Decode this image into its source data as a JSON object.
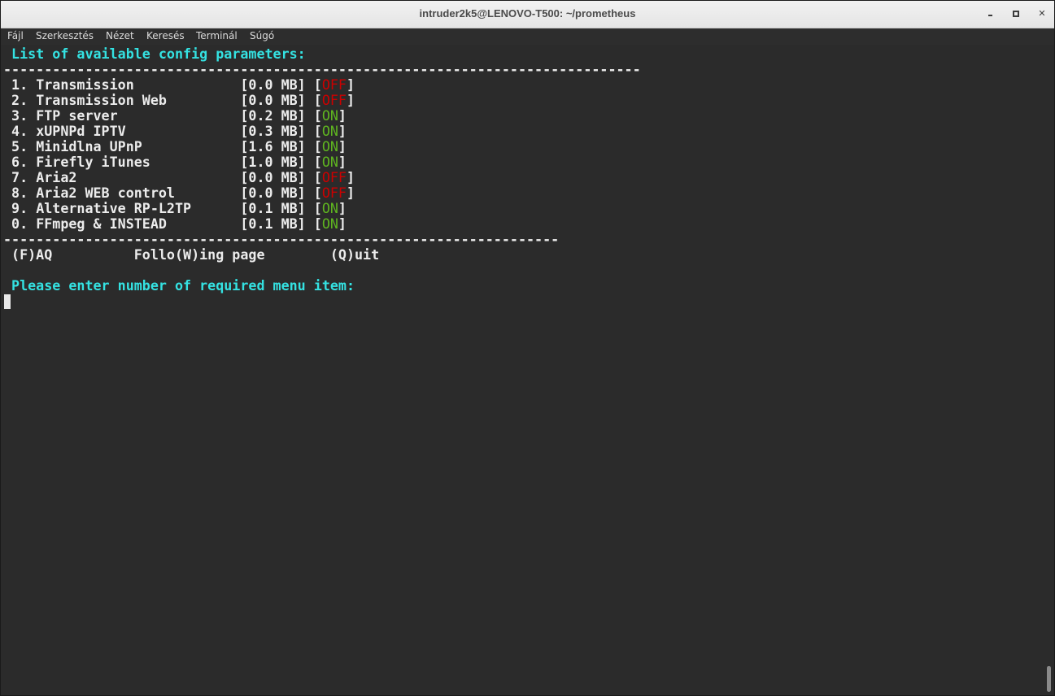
{
  "window": {
    "title": "intruder2k5@LENOVO-T500: ~/prometheus",
    "controls": [
      "minimize-icon",
      "maximize-icon",
      "close-icon"
    ]
  },
  "menubar": {
    "items": [
      "Fájl",
      "Szerkesztés",
      "Nézet",
      "Keresés",
      "Terminál",
      "Súgó"
    ]
  },
  "terminal": {
    "header": " List of available config parameters:",
    "separator_top": "------------------------------------------------------------------------------",
    "items": [
      {
        "num": "1.",
        "name": "Transmission",
        "size": "[0.0 MB]",
        "status": "OFF"
      },
      {
        "num": "2.",
        "name": "Transmission Web",
        "size": "[0.0 MB]",
        "status": "OFF"
      },
      {
        "num": "3.",
        "name": "FTP server",
        "size": "[0.2 MB]",
        "status": "ON"
      },
      {
        "num": "4.",
        "name": "xUPNPd IPTV",
        "size": "[0.3 MB]",
        "status": "ON"
      },
      {
        "num": "5.",
        "name": "Minidlna UPnP",
        "size": "[1.6 MB]",
        "status": "ON"
      },
      {
        "num": "6.",
        "name": "Firefly iTunes",
        "size": "[1.0 MB]",
        "status": "ON"
      },
      {
        "num": "7.",
        "name": "Aria2",
        "size": "[0.0 MB]",
        "status": "OFF"
      },
      {
        "num": "8.",
        "name": "Aria2 WEB control",
        "size": "[0.0 MB]",
        "status": "OFF"
      },
      {
        "num": "9.",
        "name": "Alternative RP-L2TP",
        "size": "[0.1 MB]",
        "status": "ON"
      },
      {
        "num": "0.",
        "name": "FFmpeg & INSTEAD",
        "size": "[0.1 MB]",
        "status": "ON"
      }
    ],
    "separator_bottom": "--------------------------------------------------------------------",
    "footer_line": " (F)AQ          Follo(W)ing page        (Q)uit",
    "prompt": " Please enter number of required menu item:"
  },
  "colors": {
    "cyan": "#34e2e2",
    "on": "#5fb520",
    "off": "#cc0000",
    "text": "#ececec",
    "background": "#2b2b2b"
  }
}
